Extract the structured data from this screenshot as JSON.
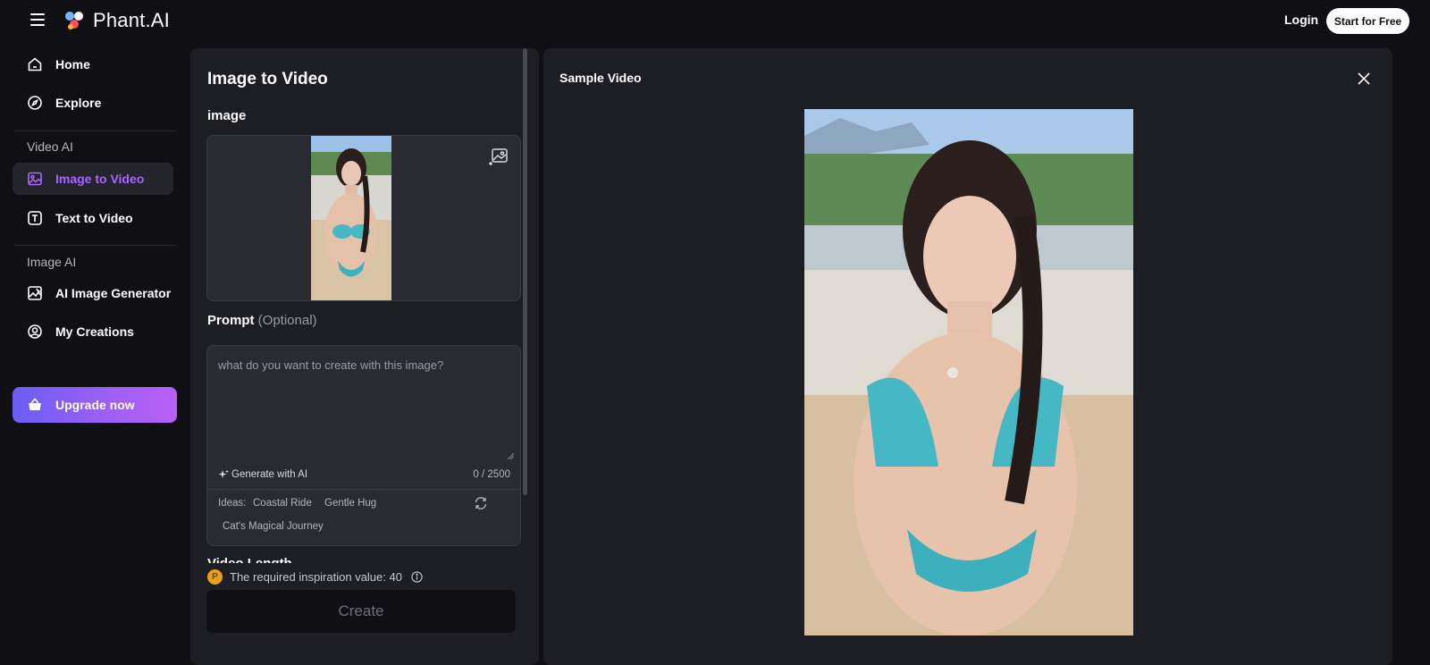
{
  "header": {
    "brand": "Phant.AI",
    "login_label": "Login",
    "start_label": "Start for Free"
  },
  "sidebar": {
    "home": "Home",
    "explore": "Explore",
    "video_section": "Video AI",
    "image_to_video": "Image to Video",
    "text_to_video": "Text to Video",
    "image_section": "Image AI",
    "ai_image_generator": "AI Image Generator",
    "my_creations": "My Creations",
    "upgrade": "Upgrade now"
  },
  "form": {
    "title": "Image to Video",
    "image_label": "image",
    "prompt_label": "Prompt",
    "prompt_optional": "(Optional)",
    "prompt_value": "",
    "prompt_placeholder": "what do you want to create with this image?",
    "generate_ai": "Generate with AI",
    "counter": "0 / 2500",
    "ideas_label": "Ideas:",
    "ideas": [
      "Coastal Ride",
      "Gentle Hug",
      "Cat's Magical Journey"
    ],
    "video_length_label": "Video Length",
    "inspiration_text": "The required inspiration value: 40",
    "create_label": "Create"
  },
  "preview": {
    "title": "Sample Video"
  },
  "colors": {
    "accent": "#a865ff",
    "upgrade_start": "#6a5df5",
    "upgrade_end": "#b85ff7",
    "coin": "#e8a01c"
  }
}
